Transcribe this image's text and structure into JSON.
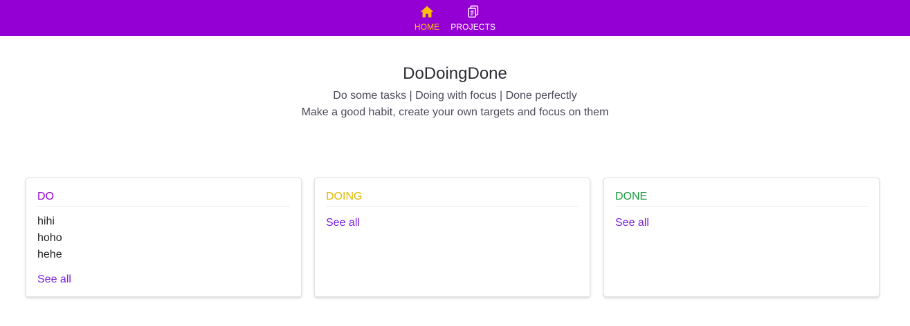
{
  "nav": {
    "items": [
      {
        "label": "HOME",
        "icon": "home-icon",
        "active": true
      },
      {
        "label": "PROJECTS",
        "icon": "clipboard-icon",
        "active": false
      }
    ],
    "active_color": "#ffc107",
    "bar_color": "#9400d3"
  },
  "hero": {
    "title": "DoDoingDone",
    "subtitle1": "Do some tasks | Doing with focus | Done perfectly",
    "subtitle2": "Make a good habit, create your own targets and focus on them"
  },
  "columns": [
    {
      "title": "DO",
      "color": "#9400d3",
      "items": [
        "hihi",
        "hoho",
        "hehe"
      ],
      "see_all": "See all"
    },
    {
      "title": "DOING",
      "color": "#e0b800",
      "items": [],
      "see_all": "See all"
    },
    {
      "title": "DONE",
      "color": "#1a9a3c",
      "items": [],
      "see_all": "See all"
    }
  ]
}
